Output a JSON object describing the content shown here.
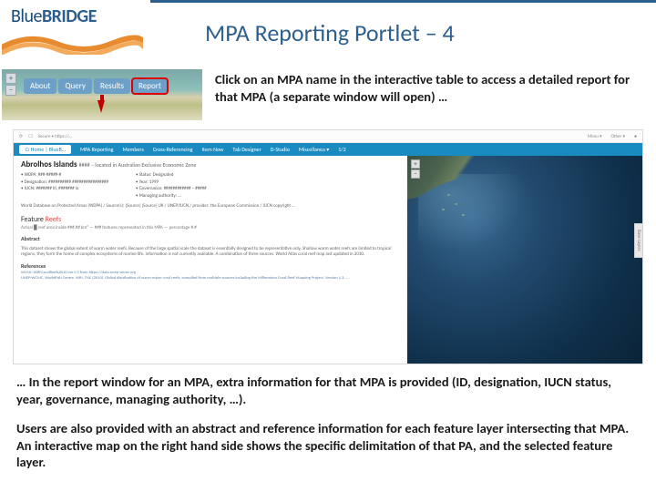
{
  "header": {
    "logo_light": "Blue",
    "logo_bold": "BRIDGE",
    "title": "MPA Reporting Portlet – 4"
  },
  "mini": {
    "zoom_in": "+",
    "zoom_out": "−",
    "tabs": {
      "about": "About",
      "query": "Query",
      "results": "Results",
      "report": "Report"
    }
  },
  "intro": "Click on an MPA name in the interactive table to access a detailed report for that MPA (a separate window will open) …",
  "screenshot": {
    "topbar": {
      "left1": "⟳",
      "left2": "☐",
      "left3": "Secure • https://…",
      "menu": "Menu ▾",
      "other": "Other ▾",
      "avatar": "●"
    },
    "nav": {
      "home": "⌂ Home | BlueB…",
      "items": [
        "MPA Reporting",
        "Members",
        "Cross-Referencing",
        "Item Now",
        "Tab Designer",
        "D-Studio",
        "Miscellanea ▾",
        "1/2"
      ]
    },
    "mpa": {
      "name": "Abrolhos Islands",
      "subtitle": "#### – located in Australian Exclusive Economic Zone",
      "meta_left": [
        "• WDPA: ###-#####-#",
        "• Designation: ########## ################",
        "• IUCN: ####### III, ####### Ia"
      ],
      "meta_right": [
        "• Status: Designated",
        "• Year: 1999",
        "• Governance: ############ – #####",
        "• Managing authority: …"
      ],
      "desc": "World Database on Protected Areas (WDPA) / Source(s): [Source] [Source] UK / UNEP/IUCN / provider: the European Commission / IUCN copyright …"
    },
    "feature": {
      "header": "Feature",
      "accent": "Reefs",
      "sub": "Actual █ reef area inside ###.## km² — ### features represented in this MPA — percentage #.#"
    },
    "abstract": {
      "hdr": "Abstract",
      "body": "This dataset shows the global extent of warm water reefs. Because of the large spatial scale the dataset is essentially designed to be representative only. Shallow warm water reefs are limited to tropical regions; they form the home of complex ecosystems of marine life. Information is not currently available. A combination of three sources. World Atlas coral reef map last updated in 2010."
    },
    "refs": {
      "hdr": "References",
      "r1": "WCMC-008-CoralReefs2010-ver1-3 from https://data.unep-wcmc.org",
      "r2": "UNEP-WCMC, WorldFish Centre, WRI, TNC (2010). Global distribution of warm-water coral reefs, compiled from multiple sources including the Millennium Coral Reef Mapping Project. Version 1.3. …"
    },
    "map": {
      "zoom_in": "+",
      "zoom_out": "−"
    },
    "side_tab": "Base Layers"
  },
  "para1": "… In the report window for an MPA, extra information for that MPA is provided (ID, designation, IUCN status, year, governance, managing authority, …).",
  "para2": "Users are also provided with an abstract and reference information for each feature layer intersecting that MPA. An interactive map on the right hand side shows the specific delimitation of that PA, and the selected feature layer."
}
